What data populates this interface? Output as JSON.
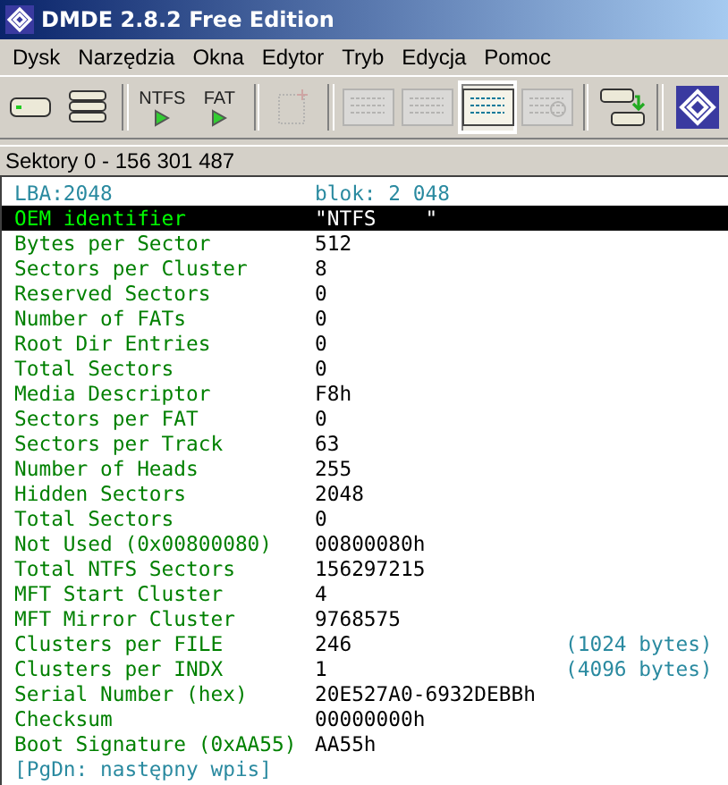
{
  "window": {
    "title": "DMDE 2.8.2 Free Edition"
  },
  "menu": [
    "Dysk",
    "Narzędzia",
    "Okna",
    "Edytor",
    "Tryb",
    "Edycja",
    "Pomoc"
  ],
  "toolbar": [
    {
      "kind": "disk",
      "disabled": false,
      "selected": false
    },
    {
      "kind": "disks",
      "disabled": false,
      "selected": false
    },
    {
      "kind": "sep"
    },
    {
      "kind": "play",
      "label": "NTFS",
      "disabled": false,
      "selected": false
    },
    {
      "kind": "play",
      "label": "FAT",
      "disabled": false,
      "selected": false
    },
    {
      "kind": "sep"
    },
    {
      "kind": "grid",
      "disabled": true,
      "selected": false
    },
    {
      "kind": "sep"
    },
    {
      "kind": "tree",
      "disabled": true,
      "selected": false
    },
    {
      "kind": "list",
      "disabled": true,
      "selected": false
    },
    {
      "kind": "list",
      "disabled": false,
      "selected": true
    },
    {
      "kind": "find",
      "disabled": true,
      "selected": false
    },
    {
      "kind": "sep"
    },
    {
      "kind": "copy",
      "disabled": false,
      "selected": false
    },
    {
      "kind": "sep"
    },
    {
      "kind": "logo",
      "disabled": false,
      "selected": false
    }
  ],
  "range": "Sektory 0 - 156 301 487",
  "header": {
    "lba": "LBA:2048",
    "block": "blok: 2 048"
  },
  "rows": [
    {
      "label": "OEM identifier",
      "value": "\"NTFS    \"",
      "selected": true
    },
    {
      "label": "Bytes per Sector",
      "value": "512",
      "selected": false
    },
    {
      "label": "Sectors per Cluster",
      "value": "8",
      "selected": false
    },
    {
      "label": "Reserved Sectors",
      "value": "0",
      "selected": false
    },
    {
      "label": "Number of FATs",
      "value": "0",
      "selected": false
    },
    {
      "label": "Root Dir Entries",
      "value": "0",
      "selected": false
    },
    {
      "label": "Total Sectors",
      "value": "0",
      "selected": false
    },
    {
      "label": "Media Descriptor",
      "value": "F8h",
      "selected": false
    },
    {
      "label": "Sectors per FAT",
      "value": "0",
      "selected": false
    },
    {
      "label": "Sectors per Track",
      "value": "63",
      "selected": false
    },
    {
      "label": "Number of Heads",
      "value": "255",
      "selected": false
    },
    {
      "label": "Hidden Sectors",
      "value": "2048",
      "selected": false
    },
    {
      "label": "Total Sectors",
      "value": "0",
      "selected": false
    },
    {
      "label": "Not Used (0x00800080)",
      "value": "00800080h",
      "selected": false
    },
    {
      "label": "Total NTFS Sectors",
      "value": "156297215",
      "selected": false
    },
    {
      "label": "MFT Start Cluster",
      "value": "4",
      "selected": false
    },
    {
      "label": "MFT Mirror Cluster",
      "value": "9768575",
      "selected": false
    },
    {
      "label": "Clusters per FILE",
      "value": "246",
      "note": "(1024 bytes)",
      "selected": false
    },
    {
      "label": "Clusters per INDX",
      "value": "1",
      "note": "(4096 bytes)",
      "selected": false
    },
    {
      "label": "Serial Number (hex)",
      "value": "20E527A0-6932DEBBh",
      "selected": false
    },
    {
      "label": "Checksum",
      "value": "00000000h",
      "selected": false
    },
    {
      "label": "Boot Signature (0xAA55)",
      "value": "AA55h",
      "selected": false
    }
  ],
  "footer": "[PgDn: następny wpis]"
}
